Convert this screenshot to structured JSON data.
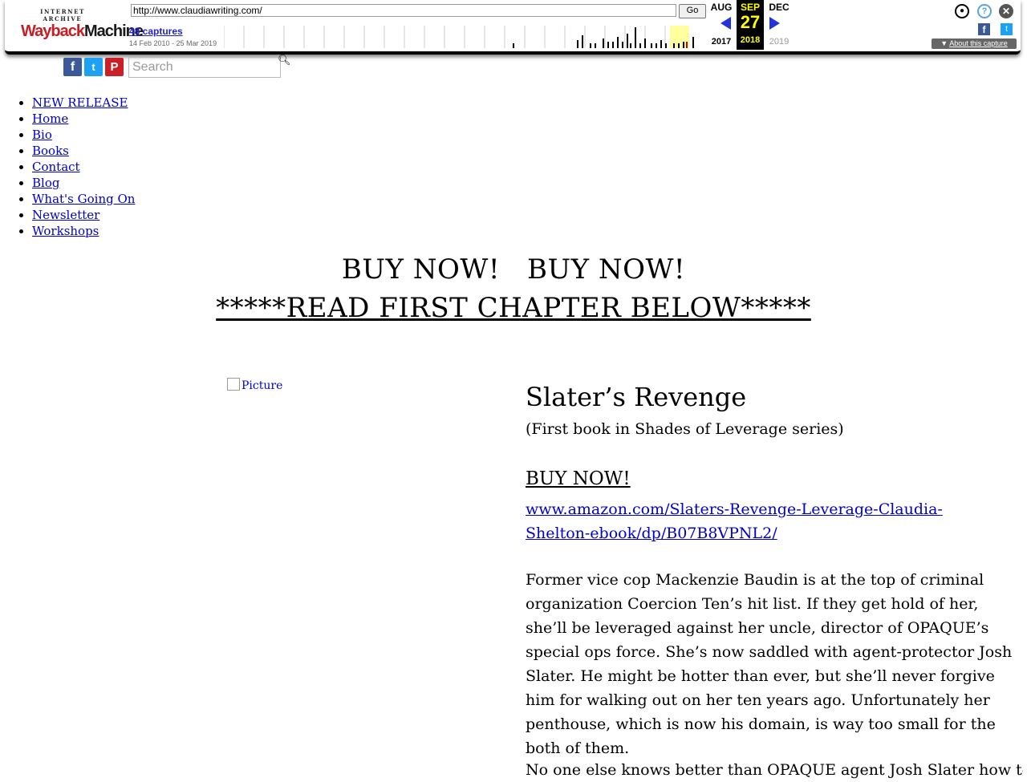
{
  "toolbar": {
    "logo_top": "INTERNET ARCHIVE",
    "logo_main_red": "Wayback",
    "logo_main_dark": "Machine",
    "url": "http://www.claudiawriting.com/",
    "go_label": "Go",
    "captures": "48 captures",
    "date_range": "14 Feb 2010 - 25 Mar 2019",
    "prev_month": "AUG",
    "cur_month": "SEP",
    "next_month": "DEC",
    "cur_day": "27",
    "prev_year": "2017",
    "cur_year": "2018",
    "next_year": "2019",
    "about_label": "About this capture",
    "accent": "#ffff00",
    "link_color": "#2222cc"
  },
  "search": {
    "placeholder": "Search"
  },
  "social": [
    "facebook-icon",
    "twitter-icon",
    "pinterest-icon"
  ],
  "nav": [
    {
      "label": "NEW RELEASE"
    },
    {
      "label": "Home"
    },
    {
      "label": "Bio"
    },
    {
      "label": "Books"
    },
    {
      "label": "Contact"
    },
    {
      "label": "Blog"
    },
    {
      "label": "What's Going On"
    },
    {
      "label": "Newsletter"
    },
    {
      "label": "Workshops"
    }
  ],
  "headline": {
    "line1": "BUY NOW!   BUY NOW!",
    "line2": "*****READ FIRST CHAPTER BELOW*****"
  },
  "picture_alt": "Picture",
  "book": {
    "title": "Slater’s Revenge",
    "subtitle": "(First book in Shades of Leverage series)",
    "buy_label": "BUY NOW!",
    "link": "www.amazon.com/Slaters-Revenge-Leverage-Claudia-Shelton-ebook/dp/B07B8VPNL2/",
    "description": "Former vice cop Mackenzie Baudin is at the top of criminal organization Coercion Ten’s hit list. If they get hold of her, she’ll be leveraged against her uncle, director of OPAQUE’s special ops force. She’s now saddled with agent-protector Josh Slater. He might be hotter than ever, but she’ll never forgive him for walking out on her ten years ago. Unfortunately her penthouse, which is now his domain, is way too small for the both of them.",
    "description2": "No one else knows better than OPAQUE agent Josh Slater how to thwart"
  }
}
